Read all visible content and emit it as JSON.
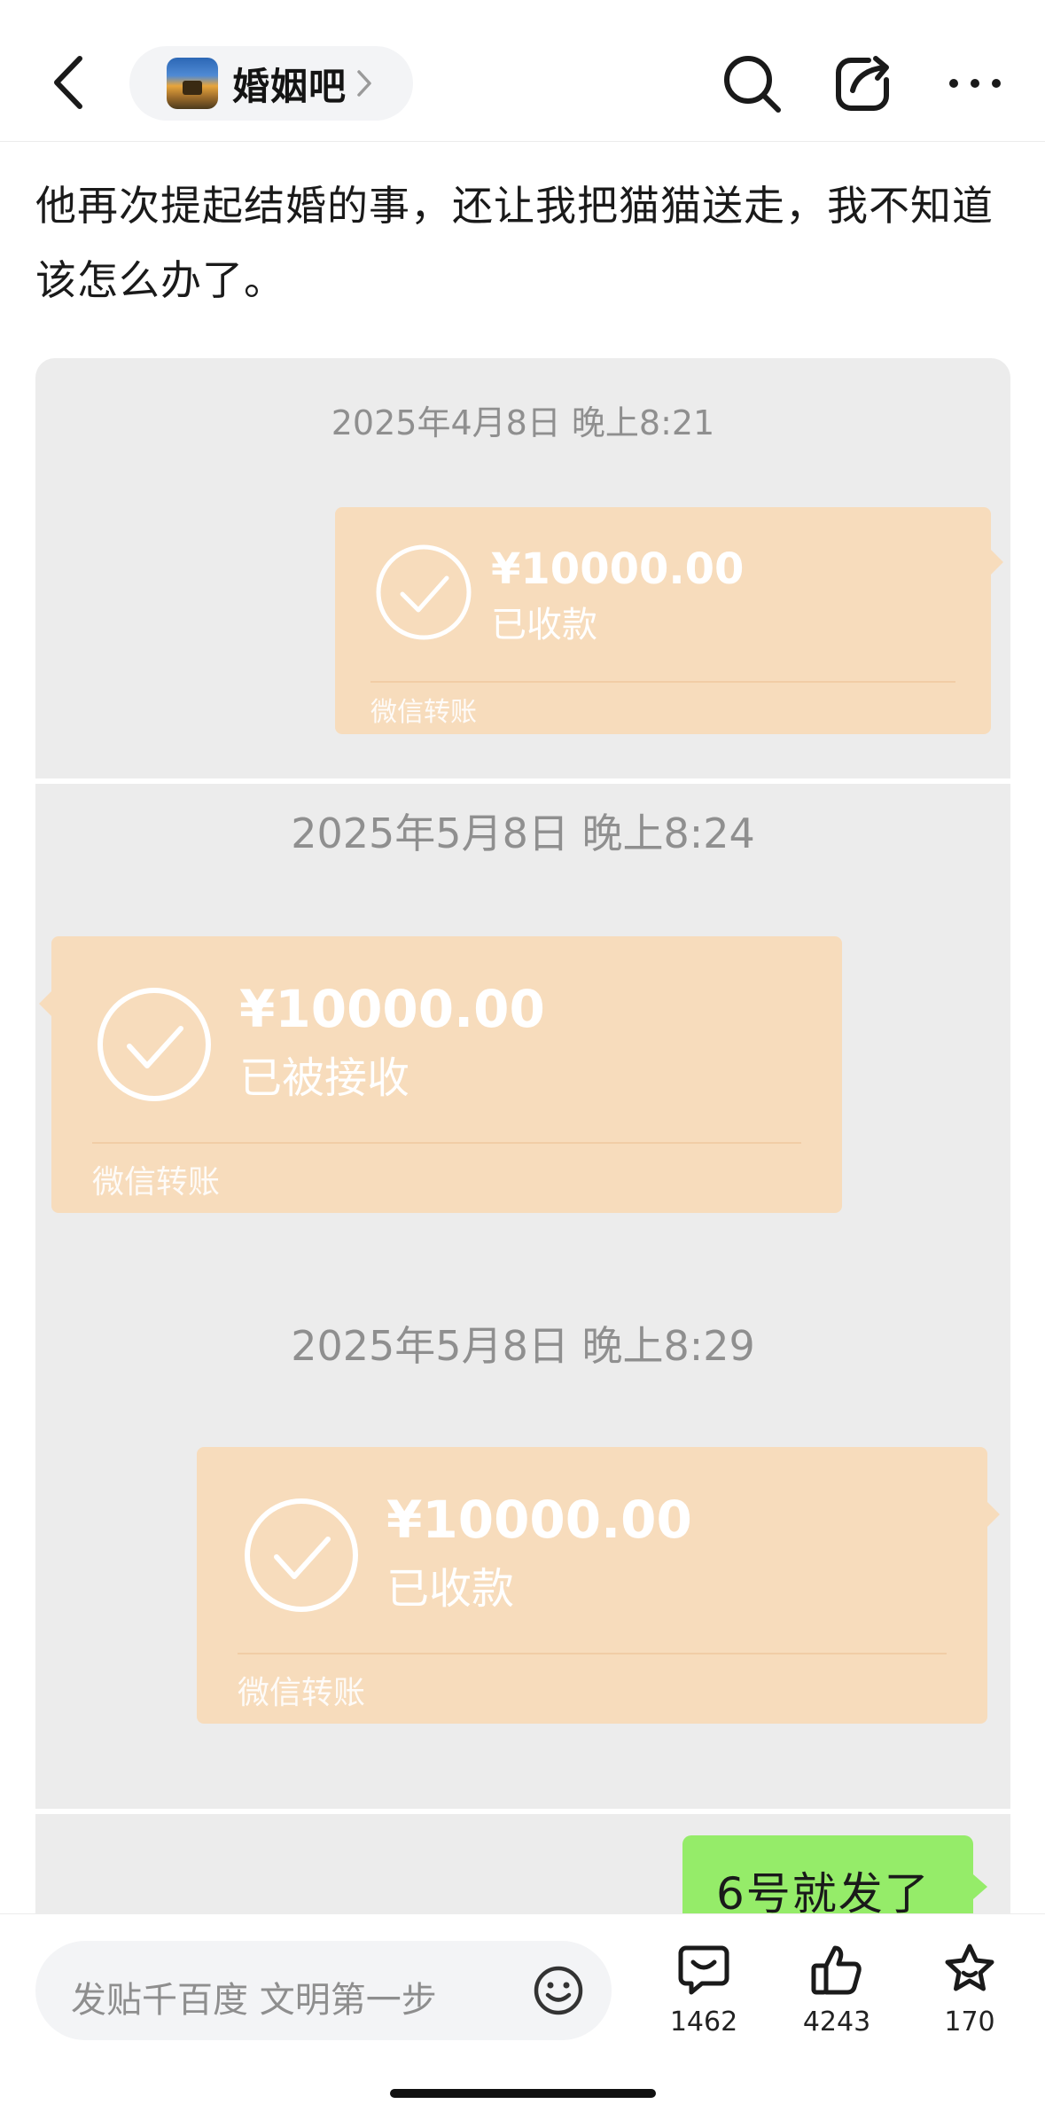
{
  "header": {
    "forum_name": "婚姻吧"
  },
  "post": {
    "title": "他再次提起结婚的事，还让我把猫猫送走，我不知道该怎么办了。"
  },
  "screenshot": {
    "messages": [
      {
        "timestamp": "2025年4月8日  晚上8:21",
        "amount": "¥10000.00",
        "status": "已收款",
        "brand": "微信转账",
        "side": "right"
      },
      {
        "timestamp": "2025年5月8日  晚上8:24",
        "amount": "¥10000.00",
        "status": "已被接收",
        "brand": "微信转账",
        "side": "left"
      },
      {
        "timestamp": "2025年5月8日  晚上8:29",
        "amount": "¥10000.00",
        "status": "已收款",
        "brand": "微信转账",
        "side": "right"
      }
    ],
    "text_bubble": "6号就发了",
    "colors": {
      "transfer_card": "#f7dcbc",
      "text_bubble": "#95ec69",
      "chat_bg": "#ececec"
    }
  },
  "bottombar": {
    "reply_placeholder": "发贴千百度 文明第一步",
    "comments_count": "1462",
    "likes_count": "4243",
    "favorites_count": "170"
  },
  "icons": [
    "back-icon",
    "chevron-right-icon",
    "search-icon",
    "share-icon",
    "more-icon",
    "check-circle-icon",
    "emoji-icon",
    "comment-icon",
    "like-icon",
    "star-icon"
  ]
}
